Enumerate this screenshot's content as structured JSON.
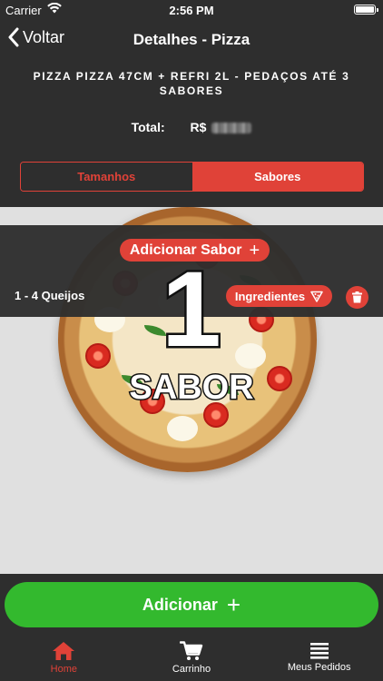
{
  "status_bar": {
    "carrier": "Carrier",
    "time": "2:56 PM"
  },
  "nav": {
    "back_label": "Voltar",
    "title": "Detalhes - Pizza"
  },
  "product": {
    "name": "PIZZA PIZZA 47CM + REFRI 2L - PEDAÇOS ATÉ 3 SABORES",
    "total_label": "Total:",
    "currency": "R$"
  },
  "segments": {
    "items": [
      {
        "label": "Tamanhos",
        "selected": false
      },
      {
        "label": "Sabores",
        "selected": true
      }
    ]
  },
  "flavors": {
    "add_label": "Adicionar Sabor",
    "count_number": "1",
    "count_word": "SABOR",
    "selected": [
      {
        "name": "1 - 4 Queijos",
        "ingredients_label": "Ingredientes"
      }
    ]
  },
  "actions": {
    "add_label": "Adicionar"
  },
  "tabbar": {
    "items": [
      {
        "label": "Home",
        "icon": "home-icon",
        "active": true
      },
      {
        "label": "Carrinho",
        "icon": "cart-icon",
        "active": false
      },
      {
        "label": "Meus Pedidos",
        "icon": "list-icon",
        "active": false
      }
    ]
  },
  "colors": {
    "accent": "#e04238",
    "bar": "#2e2e2e",
    "confirm": "#33b92e",
    "background": "#e0e0e0"
  }
}
